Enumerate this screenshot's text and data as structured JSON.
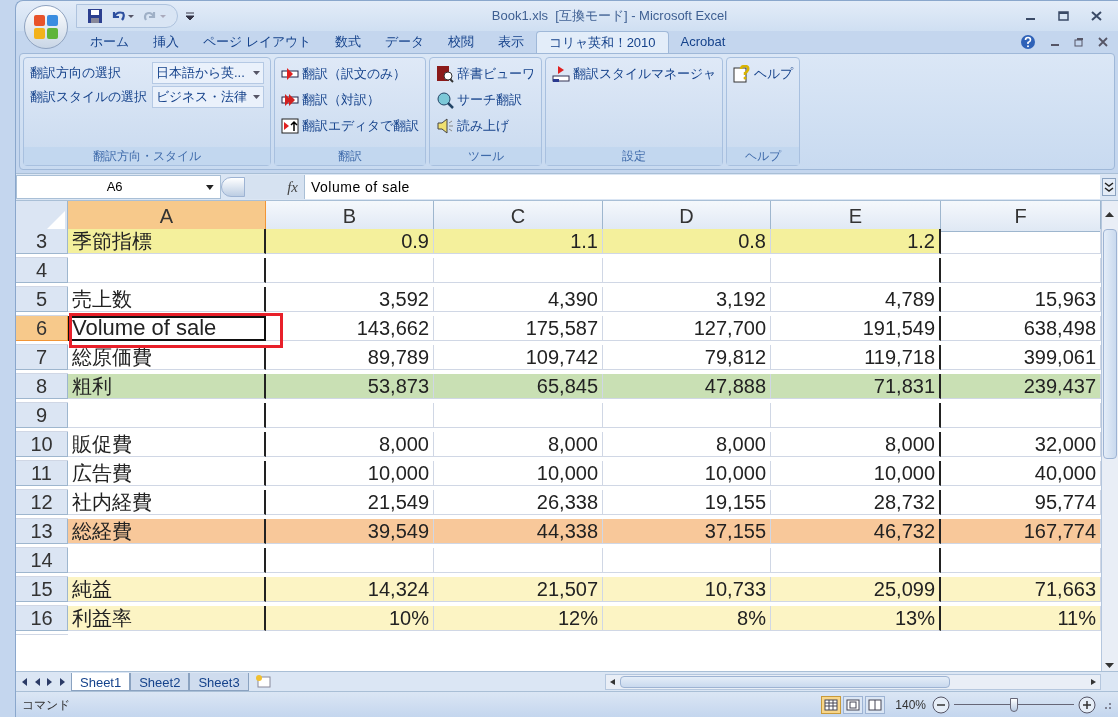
{
  "window": {
    "title": "Book1.xls  [互換モード] - Microsoft Excel"
  },
  "tabs": [
    {
      "label": "ホーム",
      "selected": false
    },
    {
      "label": "挿入",
      "selected": false
    },
    {
      "label": "ページ レイアウト",
      "selected": false
    },
    {
      "label": "数式",
      "selected": false
    },
    {
      "label": "データ",
      "selected": false
    },
    {
      "label": "校閲",
      "selected": false
    },
    {
      "label": "表示",
      "selected": false
    },
    {
      "label": "コリャ英和！2010",
      "selected": true
    },
    {
      "label": "Acrobat",
      "selected": false
    }
  ],
  "ribbon_groups": [
    {
      "label": "翻訳方向・スタイル",
      "kind": "selectors",
      "items": [
        {
          "label": "翻訳方向の選択",
          "value": "日本語から英..."
        },
        {
          "label": "翻訳スタイルの選択",
          "value": "ビジネス・法律"
        }
      ]
    },
    {
      "label": "翻訳",
      "kind": "buttons",
      "items": [
        {
          "label": "翻訳（訳文のみ）"
        },
        {
          "label": "翻訳（対訳）"
        },
        {
          "label": "翻訳エディタで翻訳"
        }
      ]
    },
    {
      "label": "ツール",
      "kind": "buttons",
      "items": [
        {
          "label": "辞書ビューワ"
        },
        {
          "label": "サーチ翻訳"
        },
        {
          "label": "読み上げ"
        }
      ]
    },
    {
      "label": "設定",
      "kind": "buttons",
      "items": [
        {
          "label": "翻訳スタイルマネージャ"
        }
      ]
    },
    {
      "label": "ヘルプ",
      "kind": "buttons",
      "items": [
        {
          "label": "ヘルプ"
        }
      ]
    }
  ],
  "formula_bar": {
    "name_box": "A6",
    "function_label": "fx",
    "formula": "Volume of sale"
  },
  "columns": [
    {
      "label": "A",
      "selected": true
    },
    {
      "label": "B",
      "selected": false
    },
    {
      "label": "C",
      "selected": false
    },
    {
      "label": "D",
      "selected": false
    },
    {
      "label": "E",
      "selected": false
    },
    {
      "label": "F",
      "selected": false
    }
  ],
  "rows": [
    {
      "number": "3",
      "selected": false,
      "color": "#f4f09c",
      "cells": [
        "季節指標",
        "0.9",
        "1.1",
        "0.8",
        "1.2"
      ]
    },
    {
      "number": "4",
      "selected": false
    },
    {
      "number": "5",
      "selected": false,
      "cells": [
        "売上数",
        "3,592",
        "4,390",
        "3,192",
        "4,789",
        "15,963"
      ]
    },
    {
      "number": "6",
      "selected": true,
      "cells": [
        "Volume of sale",
        "143,662",
        "175,587",
        "127,700",
        "191,549",
        "638,498"
      ]
    },
    {
      "number": "7",
      "selected": false,
      "cells": [
        "総原価費",
        "89,789",
        "109,742",
        "79,812",
        "119,718",
        "399,061"
      ]
    },
    {
      "number": "8",
      "selected": false,
      "color": "#c9e0b4",
      "cells": [
        "粗利",
        "53,873",
        "65,845",
        "47,888",
        "71,831",
        "239,437"
      ]
    },
    {
      "number": "9",
      "selected": false
    },
    {
      "number": "10",
      "selected": false,
      "cells": [
        "販促費",
        "8,000",
        "8,000",
        "8,000",
        "8,000",
        "32,000"
      ]
    },
    {
      "number": "11",
      "selected": false,
      "cells": [
        "広告費",
        "10,000",
        "10,000",
        "10,000",
        "10,000",
        "40,000"
      ]
    },
    {
      "number": "12",
      "selected": false,
      "cells": [
        "社内経費",
        "21,549",
        "26,338",
        "19,155",
        "28,732",
        "95,774"
      ]
    },
    {
      "number": "13",
      "selected": false,
      "color": "#f8c89a",
      "cells": [
        "総経費",
        "39,549",
        "44,338",
        "37,155",
        "46,732",
        "167,774"
      ]
    },
    {
      "number": "14",
      "selected": false
    },
    {
      "number": "15",
      "selected": false,
      "color": "#fcf4c4",
      "cells": [
        "純益",
        "14,324",
        "21,507",
        "10,733",
        "25,099",
        "71,663"
      ]
    },
    {
      "number": "16",
      "selected": false,
      "color": "#fcf4c4",
      "cells": [
        "利益率",
        "10%",
        "12%",
        "8%",
        "13%",
        "11%"
      ]
    }
  ],
  "sheet_tabs": [
    {
      "label": "Sheet1",
      "selected": true
    },
    {
      "label": "Sheet2",
      "selected": false
    },
    {
      "label": "Sheet3",
      "selected": false
    }
  ],
  "status_bar": {
    "mode": "コマンド",
    "view_buttons": [
      {
        "selected": true
      },
      {
        "selected": false
      },
      {
        "selected": false
      }
    ],
    "zoom": "140%",
    "zoom_slider": {
      "level": 0.5
    }
  }
}
